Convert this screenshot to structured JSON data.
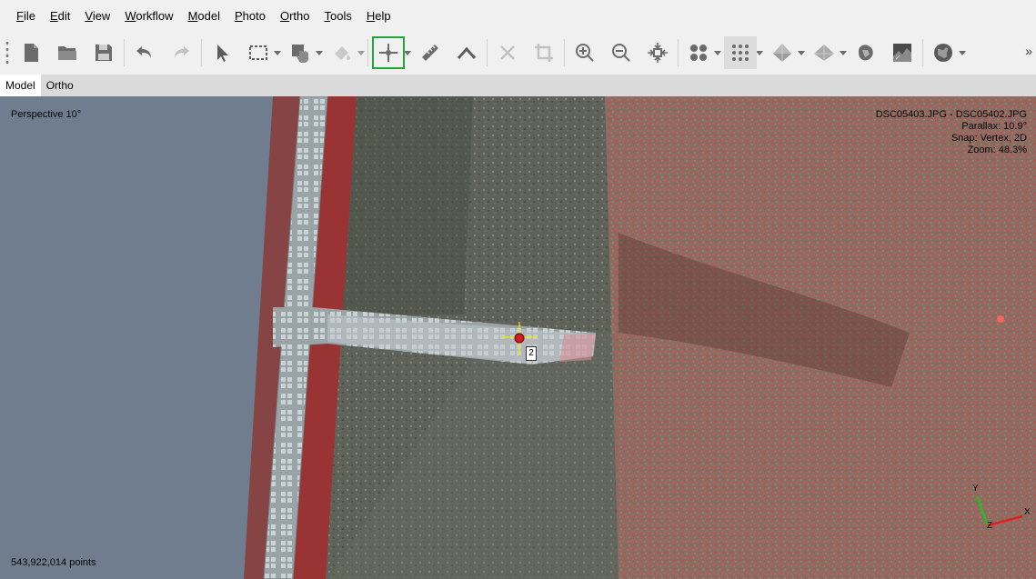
{
  "menu": [
    {
      "label": "File",
      "key": "F",
      "rest": "ile"
    },
    {
      "label": "Edit",
      "key": "E",
      "rest": "dit"
    },
    {
      "label": "View",
      "key": "V",
      "rest": "iew"
    },
    {
      "label": "Workflow",
      "key": "W",
      "rest": "orkflow"
    },
    {
      "label": "Model",
      "key": "M",
      "rest": "odel"
    },
    {
      "label": "Photo",
      "key": "P",
      "rest": "hoto"
    },
    {
      "label": "Ortho",
      "key": "O",
      "rest": "rtho"
    },
    {
      "label": "Tools",
      "key": "T",
      "rest": "ools"
    },
    {
      "label": "Help",
      "key": "H",
      "rest": "elp"
    }
  ],
  "toolbar": {
    "icons": [
      "new-icon",
      "open-icon",
      "save-icon",
      "undo-icon",
      "redo-icon",
      "navigation-icon",
      "rectangle-selection-icon",
      "draw-polygon-icon",
      "fill-icon",
      "place-marker-icon",
      "ruler-icon",
      "polyline-icon",
      "delete-icon",
      "crop-icon",
      "zoom-in-icon",
      "zoom-out-icon",
      "reset-view-icon",
      "point-cloud-icon",
      "dense-cloud-icon",
      "model-shaded-icon",
      "model-textured-icon",
      "tiled-model-icon",
      "dem-icon",
      "orthomosaic-icon"
    ],
    "overflow": "»"
  },
  "tabs": [
    {
      "label": "Model",
      "selected": true
    },
    {
      "label": "Ortho",
      "selected": false
    }
  ],
  "viewport": {
    "projection": "Perspective 10°",
    "images": "DSC05403.JPG - DSC05402.JPG",
    "parallax": "Parallax: 10.9°",
    "snap": "Snap: Vertex, 2D",
    "zoom": "Zoom: 48.3%",
    "points": "543,922,014 points",
    "marker_label": "2",
    "axes": {
      "x": "X",
      "y": "Y",
      "z": "Z"
    },
    "colors": {
      "marker_cross": "#f2e600",
      "marker_dot": "#d02020",
      "axis_x": "#e02020",
      "axis_y": "#20c020",
      "axis_z": "#2040e0",
      "active_tool_border": "#23a33b"
    }
  }
}
